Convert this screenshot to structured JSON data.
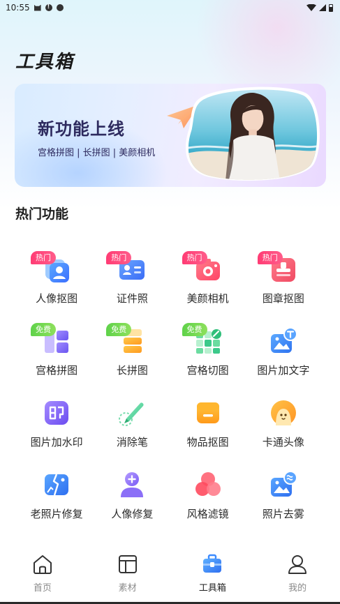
{
  "status_bar": {
    "time": "10:55"
  },
  "page_title": "工具箱",
  "banner": {
    "title": "新功能上线",
    "subtitle": "宫格拼图 | 长拼图 | 美颜相机"
  },
  "section_title": "热门功能",
  "tools": [
    {
      "label": "人像抠图",
      "badge": "热门",
      "badge_type": "hot",
      "icon": "portrait-cutout-icon"
    },
    {
      "label": "证件照",
      "badge": "热门",
      "badge_type": "hot",
      "icon": "id-photo-icon"
    },
    {
      "label": "美颜相机",
      "badge": "热门",
      "badge_type": "hot",
      "icon": "beauty-camera-icon"
    },
    {
      "label": "图章抠图",
      "badge": "热门",
      "badge_type": "hot",
      "icon": "stamp-cutout-icon"
    },
    {
      "label": "宫格拼图",
      "badge": "免费",
      "badge_type": "free",
      "icon": "grid-collage-icon"
    },
    {
      "label": "长拼图",
      "badge": "免费",
      "badge_type": "free",
      "icon": "long-collage-icon"
    },
    {
      "label": "宫格切图",
      "badge": "免费",
      "badge_type": "free",
      "icon": "grid-cut-icon"
    },
    {
      "label": "图片加文字",
      "badge": "",
      "badge_type": "",
      "icon": "add-text-icon"
    },
    {
      "label": "图片加水印",
      "badge": "",
      "badge_type": "",
      "icon": "watermark-icon"
    },
    {
      "label": "消除笔",
      "badge": "",
      "badge_type": "",
      "icon": "eraser-pen-icon"
    },
    {
      "label": "物品抠图",
      "badge": "",
      "badge_type": "",
      "icon": "object-cutout-icon"
    },
    {
      "label": "卡通头像",
      "badge": "",
      "badge_type": "",
      "icon": "cartoon-avatar-icon"
    },
    {
      "label": "老照片修复",
      "badge": "",
      "badge_type": "",
      "icon": "old-photo-repair-icon"
    },
    {
      "label": "人像修复",
      "badge": "",
      "badge_type": "",
      "icon": "portrait-repair-icon"
    },
    {
      "label": "风格滤镜",
      "badge": "",
      "badge_type": "",
      "icon": "style-filter-icon"
    },
    {
      "label": "照片去雾",
      "badge": "",
      "badge_type": "",
      "icon": "dehaze-icon"
    }
  ],
  "nav": [
    {
      "label": "首页",
      "icon": "home-icon",
      "active": false
    },
    {
      "label": "素材",
      "icon": "materials-icon",
      "active": false
    },
    {
      "label": "工具箱",
      "icon": "toolbox-icon",
      "active": true
    },
    {
      "label": "我的",
      "icon": "profile-icon",
      "active": false
    }
  ],
  "colors": {
    "hot_badge": "#ff3c74",
    "free_badge": "#5fd24a",
    "accent_blue": "#3d8bff"
  }
}
